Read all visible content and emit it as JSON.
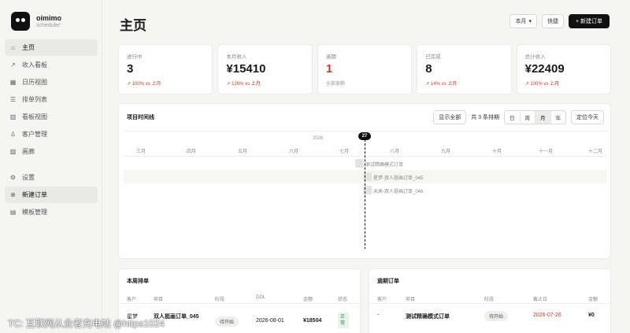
{
  "brand": {
    "name": "oimimo",
    "subtitle": "scheduler"
  },
  "nav_primary": [
    {
      "icon": "home-icon",
      "glyph": "⌂",
      "label": "主页",
      "active": true
    },
    {
      "icon": "trend-icon",
      "glyph": "↗",
      "label": "收入看板"
    },
    {
      "icon": "calendar-icon",
      "glyph": "▦",
      "label": "日历视图"
    },
    {
      "icon": "list-icon",
      "glyph": "☰",
      "label": "排单列表"
    },
    {
      "icon": "kanban-icon",
      "glyph": "▥",
      "label": "看板视图"
    },
    {
      "icon": "users-icon",
      "glyph": "♙",
      "label": "客户管理"
    },
    {
      "icon": "image-icon",
      "glyph": "▧",
      "label": "画廊"
    }
  ],
  "nav_secondary": [
    {
      "icon": "gear-icon",
      "glyph": "⚙",
      "label": "设置"
    },
    {
      "icon": "plus-circle-icon",
      "glyph": "⊕",
      "label": "新建订单",
      "active": true
    },
    {
      "icon": "template-icon",
      "glyph": "▤",
      "label": "模板管理"
    }
  ],
  "header": {
    "title": "主页",
    "period_select": "本月",
    "quick_label": "快捷",
    "new_order_label": "+ 新建订单"
  },
  "stats": [
    {
      "label": "进行中",
      "value": "3",
      "sub": "↗ 100% vs 上月"
    },
    {
      "label": "本月收入",
      "value": "¥15410",
      "sub": "↗ 126% vs 上月"
    },
    {
      "label": "逾期",
      "value": "1",
      "sub": "全部逾期",
      "red": true,
      "gray_sub": true
    },
    {
      "label": "已完成",
      "value": "8",
      "sub": "↗ 14% vs 上月"
    },
    {
      "label": "总计收入",
      "value": "¥22409",
      "sub": "↗ 100% vs 上月"
    }
  ],
  "timeline": {
    "title": "项目时间线",
    "show_all": "显示全部",
    "count_text": "共 3 条排期",
    "scales": [
      "日",
      "周",
      "月",
      "年"
    ],
    "active_scale": "月",
    "locate_today": "定位今天",
    "year": "2026",
    "today_badge": "27",
    "months": [
      "三月",
      "四月",
      "五月",
      "六月",
      "七月",
      "八月",
      "九月",
      "十月",
      "十一月",
      "十二月"
    ],
    "rows": [
      {
        "label": "测试精确模式订单"
      },
      {
        "label": "星梦-双人挺画订单_045"
      },
      {
        "label": "未来-双人挺画订单_046"
      }
    ]
  },
  "weekly": {
    "title": "本周排单",
    "headers": [
      "客户",
      "项目",
      "阶段",
      "DDL",
      "金额",
      "状态"
    ],
    "rows": [
      {
        "client": "星梦",
        "project": "双人挺画订单_045",
        "stage": "待开始",
        "ddl": "2026-08-01",
        "amount": "¥18504",
        "status": "正常"
      }
    ]
  },
  "overdue": {
    "title": "逾期订单",
    "headers": [
      "客户",
      "项目",
      "阶段",
      "截止日",
      "金额"
    ],
    "rows": [
      {
        "client": "-",
        "project": "测试精确模式订单",
        "stage": "待开始",
        "due": "2026-07-26",
        "amount": "¥0"
      }
    ]
  },
  "watermark": "TC: 互联网从业者充电站 @https1024",
  "colors": {
    "accent_dark": "#111111",
    "overdue_red": "#d0362f",
    "status_green": "#2f8a45"
  }
}
